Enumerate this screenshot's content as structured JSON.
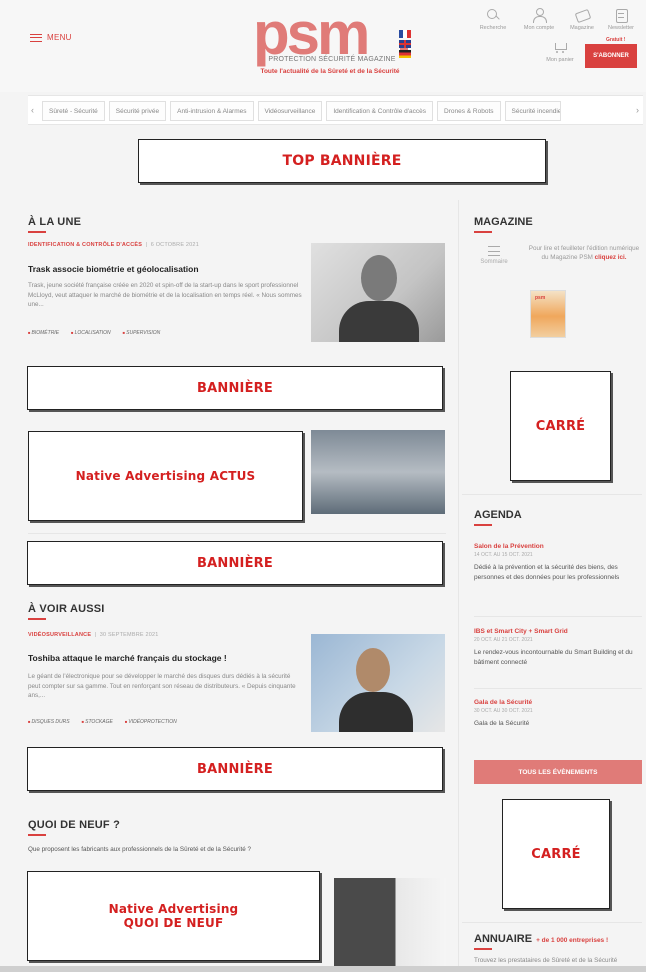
{
  "header": {
    "menu_label": "MENU",
    "logo_text": "psm",
    "logo_subtitle": "PROTECTION SÉCURITÉ MAGAZINE",
    "tagline": "Toute l'actualité de la Sûreté et de la Sécurité",
    "icons": [
      {
        "icon": "search-icon",
        "label": "Recherche"
      },
      {
        "icon": "user-icon",
        "label": "Mon compte"
      },
      {
        "icon": "magazine-icon",
        "label": "Magazine"
      },
      {
        "icon": "newsletter-icon",
        "label": "Newsletter"
      }
    ],
    "newsletter_badge": "Gratuit !",
    "cart_label": "Mon panier",
    "subscribe_label": "S'ABONNER"
  },
  "categories": [
    "Sûreté - Sécurité",
    "Sécurité privée",
    "Anti-intrusion & Alarmes",
    "Vidéosurveillance",
    "Identification & Contrôle d'accès",
    "Drones & Robots",
    "Sécurité incendie"
  ],
  "ads": {
    "top_banner": "TOP BANNIÈRE",
    "banner": "BANNIÈRE",
    "carre": "CARRÉ",
    "native_actus": "Native Advertising ACTUS",
    "native_quoi_line1": "Native Advertising",
    "native_quoi_line2": "QUOI DE NEUF"
  },
  "main": {
    "a_la_une": {
      "title": "À LA UNE",
      "kicker": "IDENTIFICATION & CONTRÔLE D'ACCÈS",
      "date": "6 OCTOBRE 2021",
      "headline": "Trask associe biométrie et géolocalisation",
      "excerpt": "Trask, jeune société française créée en 2020 et spin-off de la start-up dans le sport professionnel McLloyd, veut attaquer le marché de biométrie et de la localisation en temps réel. « Nous sommes une...",
      "tags": [
        "BIOMÉTRIE",
        "LOCALISATION",
        "SUPERVISION"
      ]
    },
    "a_voir_aussi": {
      "title": "À VOIR AUSSI",
      "kicker": "VIDÉOSURVEILLANCE",
      "date": "30 SEPTEMBRE 2021",
      "headline": "Toshiba attaque le marché français du stockage !",
      "excerpt": "Le géant de l'électronique pour se développer le marché des disques durs dédiés à la sécurité peut compter sur sa gamme. Tout en renforçant son réseau de distributeurs. « Depuis cinquante ans,...",
      "tags": [
        "DISQUES DURS",
        "STOCKAGE",
        "VIDÉOPROTECTION"
      ]
    },
    "quoi_de_neuf": {
      "title": "QUOI DE NEUF ?",
      "intro": "Que proposent les fabricants aux professionnels de la Sûreté et de la Sécurité ?"
    }
  },
  "sidebar": {
    "magazine": {
      "title": "MAGAZINE",
      "sommaire": "Sommaire",
      "desc": "Pour lire et feuilleter l'édition numérique du Magazine PSM",
      "link": "cliquez ici."
    },
    "agenda": {
      "title": "AGENDA",
      "events": [
        {
          "title": "Salon de la Prévention",
          "dates": "14 OCT. AU 15 OCT. 2021",
          "desc": "Dédié à la prévention et la sécurité des biens, des personnes et des données pour les professionnels"
        },
        {
          "title": "IBS et Smart City + Smart Grid",
          "dates": "20 OCT. AU 21 OCT. 2021",
          "desc": "Le rendez-vous incontournable du Smart Building et du bâtiment connecté"
        },
        {
          "title": "Gala de la Sécurité",
          "dates": "30 OCT. AU 30 OCT. 2021",
          "desc": "Gala de la Sécurité"
        }
      ],
      "all_events": "TOUS LES ÉVÈNEMENTS"
    },
    "annuaire": {
      "title": "ANNUAIRE",
      "badge": "+ de 1 000 entreprises !",
      "intro": "Trouvez les prestataires de Sûreté et de la Sécurité"
    }
  }
}
